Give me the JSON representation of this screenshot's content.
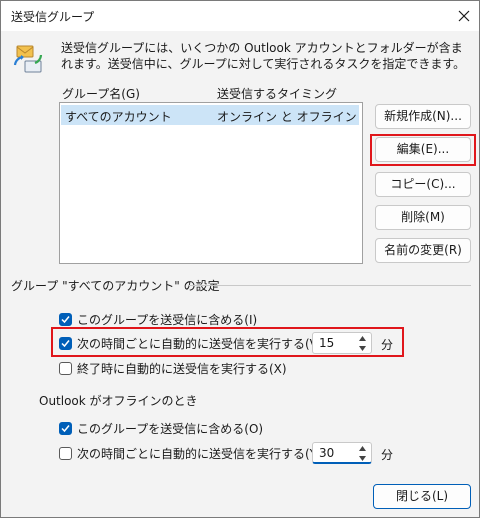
{
  "window": {
    "title": "送受信グループ"
  },
  "intro": {
    "text": "送受信グループには、いくつかの Outlook アカウントとフォルダーが含まれます。送受信中に、グループに対して実行されるタスクを指定できます。"
  },
  "list": {
    "headers": {
      "name": "グループ名(G)",
      "timing": "送受信するタイミング"
    },
    "rows": [
      {
        "name": "すべてのアカウント",
        "timing": "オンライン と オフライン"
      }
    ]
  },
  "buttons": {
    "new": "新規作成(N)...",
    "edit": "編集(E)...",
    "copy": "コピー(C)...",
    "delete": "削除(M)",
    "rename": "名前の変更(R)",
    "close": "閉じる(L)"
  },
  "group_settings": {
    "heading": "グループ \"すべてのアカウント\" の設定",
    "online": {
      "include_label": "このグループを送受信に含める(I)",
      "include_checked": true,
      "schedule_label": "次の時間ごとに自動的に送受信を実行する(V)",
      "schedule_checked": true,
      "schedule_value": "15",
      "schedule_unit": "分",
      "on_exit_label": "終了時に自動的に送受信を実行する(X)",
      "on_exit_checked": false
    },
    "offline": {
      "heading": "Outlook がオフラインのとき",
      "include_label": "このグループを送受信に含める(O)",
      "include_checked": true,
      "schedule_label": "次の時間ごとに自動的に送受信を実行する(Y)",
      "schedule_checked": false,
      "schedule_value": "30",
      "schedule_unit": "分"
    }
  },
  "colors": {
    "accent": "#005fb8",
    "selection": "#cce4f7",
    "highlight": "#e0161b"
  }
}
